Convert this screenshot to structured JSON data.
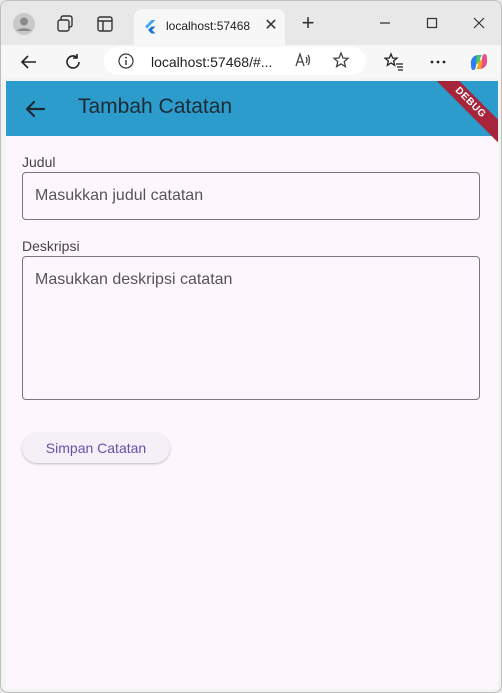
{
  "browser": {
    "tab_title": "localhost:57468",
    "tab_close": "✕",
    "new_tab": "+",
    "url": "localhost:57468/#...",
    "read_aloud": "Aͅ"
  },
  "app": {
    "title": "Tambah Catatan",
    "debug_banner": "DEBUG",
    "accent_color": "#2b9ccc",
    "form": {
      "title_label": "Judul",
      "title_placeholder": "Masukkan judul catatan",
      "description_label": "Deskripsi",
      "description_placeholder": "Masukkan deskripsi catatan",
      "save_button": "Simpan Catatan"
    }
  },
  "icons": {
    "profile": "profile-icon",
    "workspaces": "workspaces-icon",
    "tab_actions": "tab-actions-icon",
    "back": "back-arrow-icon",
    "refresh": "refresh-icon",
    "info": "info-icon",
    "favorite": "star-icon",
    "favorites_list": "favorites-list-icon",
    "more": "more-icon",
    "copilot": "copilot-icon"
  }
}
